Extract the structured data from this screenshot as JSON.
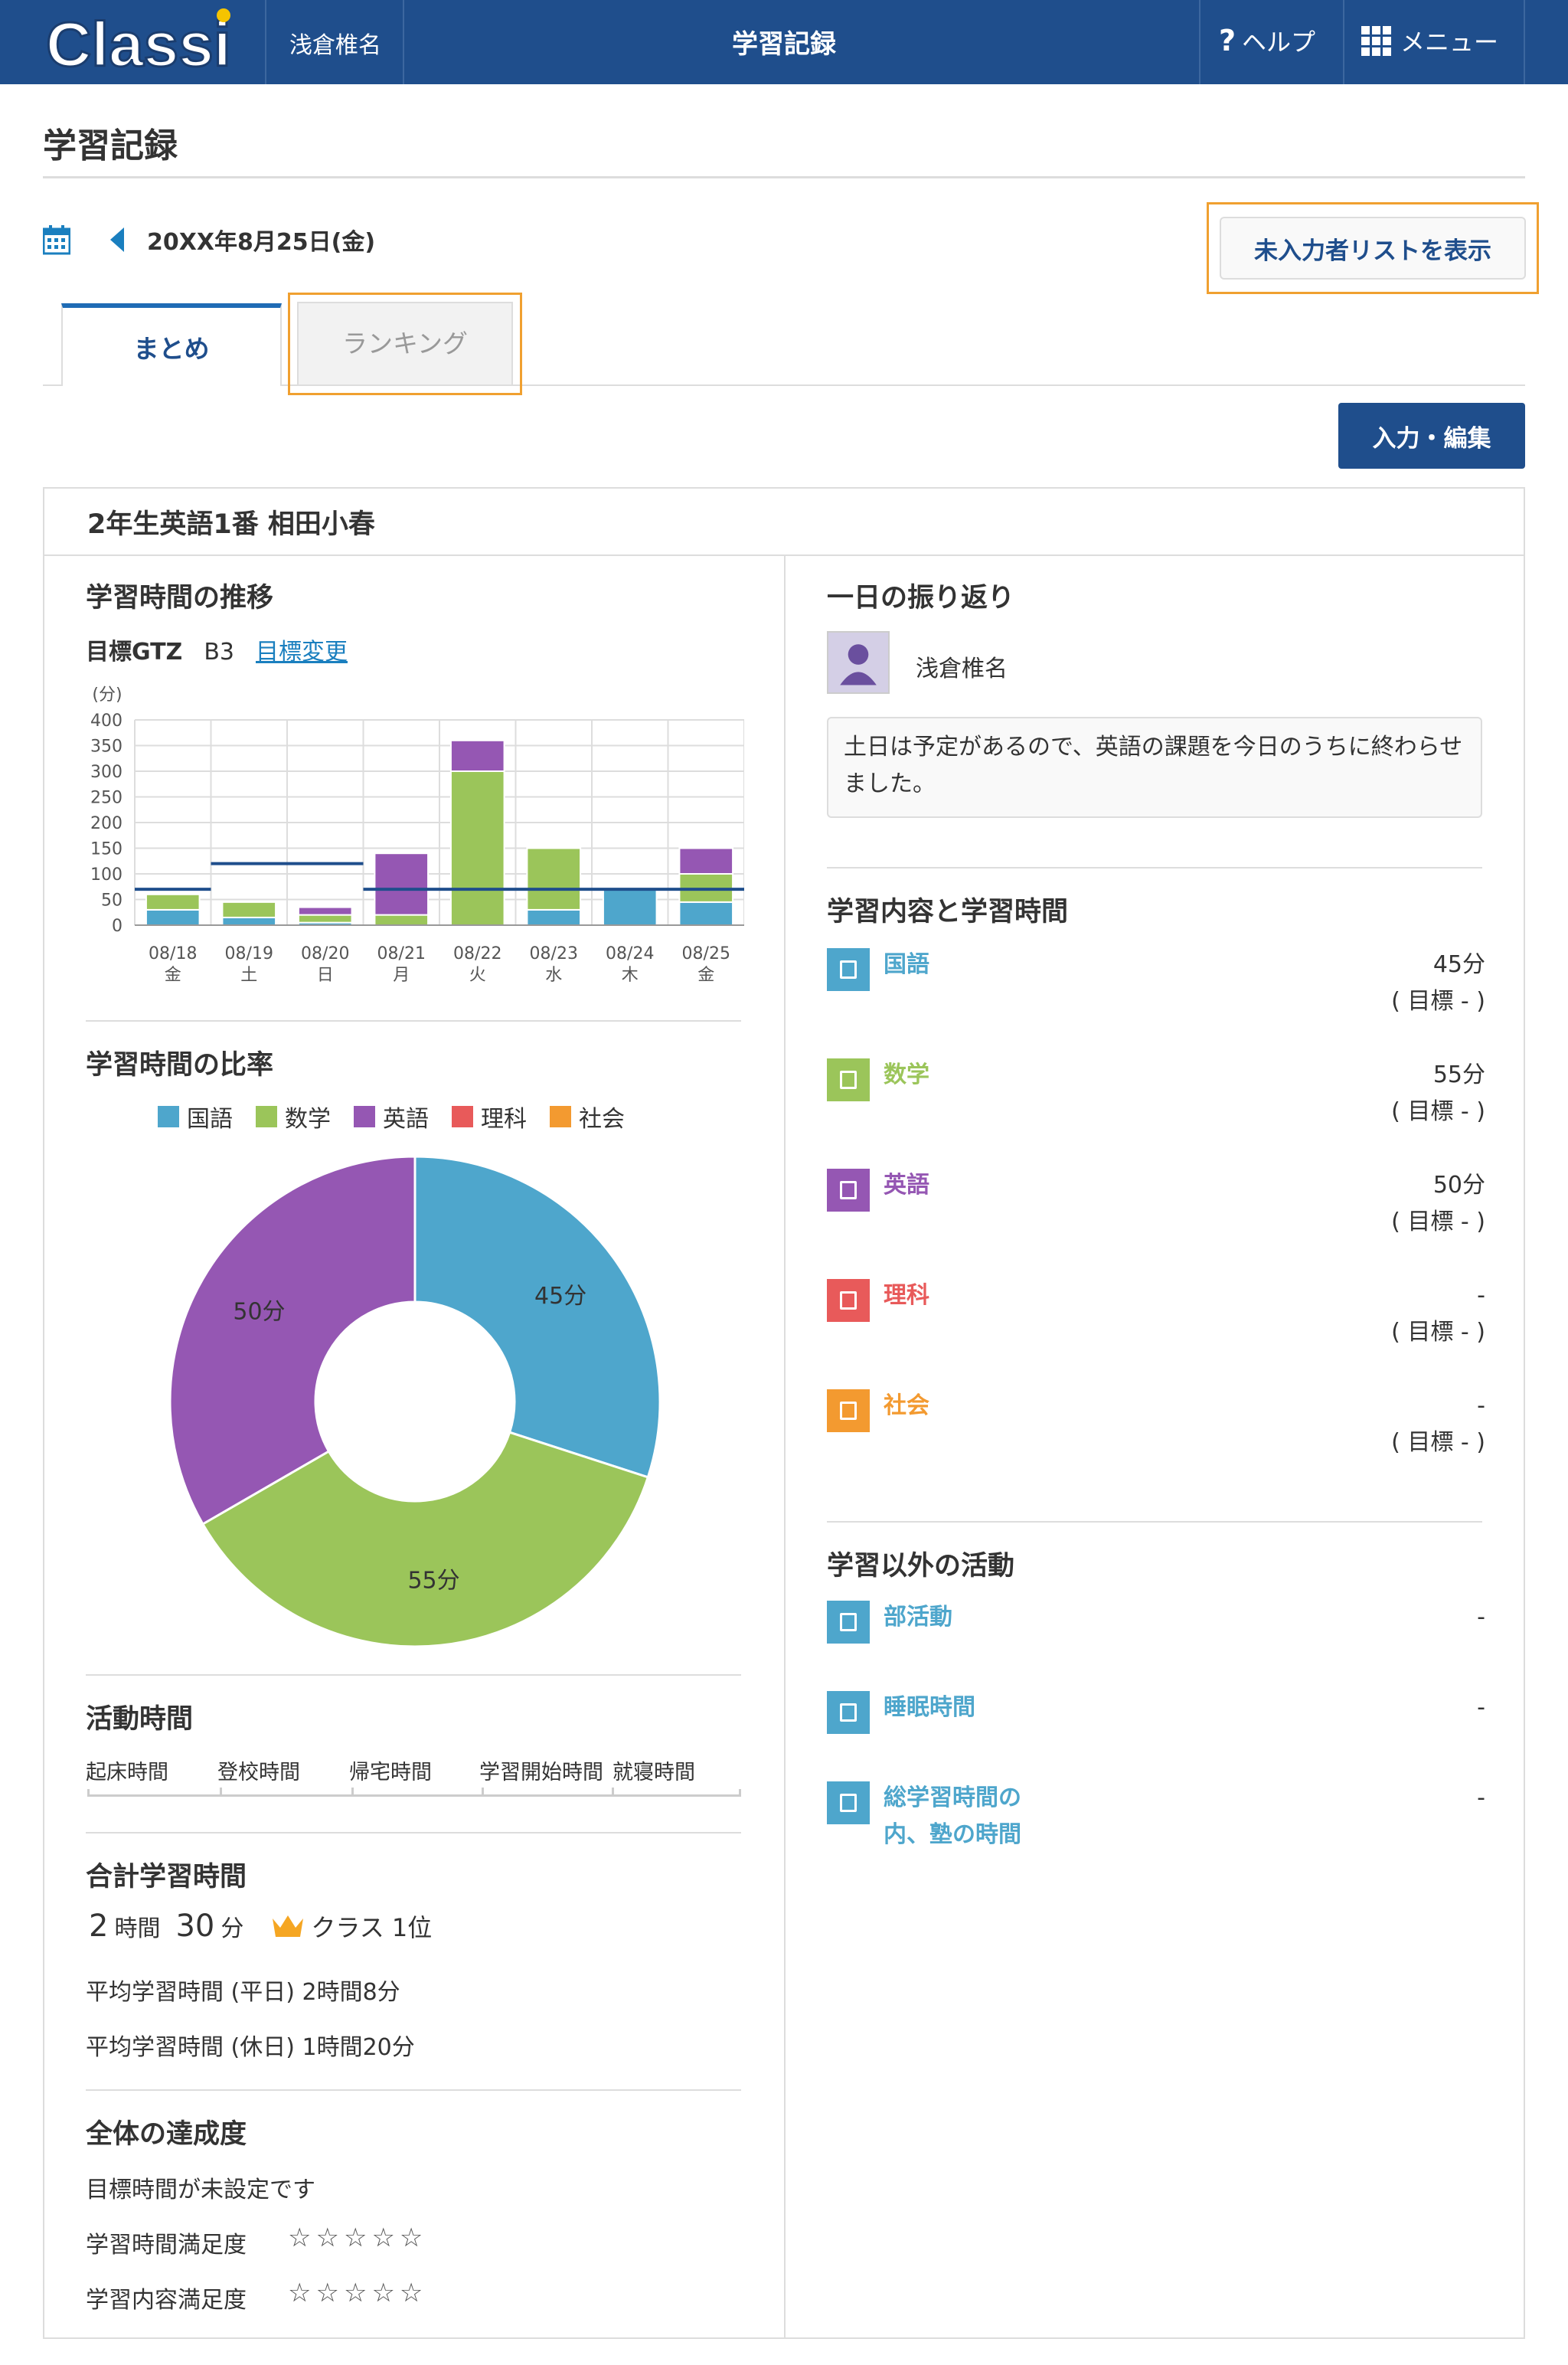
{
  "header": {
    "logo_text": "Classi",
    "user_name": "浅倉椎名",
    "screen_title": "学習記録",
    "help_label": "ヘルプ",
    "menu_label": "メニュー"
  },
  "page": {
    "title": "学習記録",
    "date": "20XX年8月25日(金)",
    "unentered_button": "未入力者リストを表示",
    "tabs": [
      {
        "label": "まとめ",
        "active": true
      },
      {
        "label": "ランキング",
        "active": false
      }
    ],
    "edit_button": "入力・編集"
  },
  "student": {
    "heading": "2年生英語1番 相田小春"
  },
  "trend": {
    "title": "学習時間の推移",
    "goal_label": "目標GTZ",
    "goal_value": "B3",
    "goal_change_link": "目標変更"
  },
  "ratio": {
    "title": "学習時間の比率"
  },
  "colors": {
    "japanese": "#4ea6cc",
    "math": "#9bc55a",
    "english": "#9557b3",
    "science": "#e85a5a",
    "social": "#f39a30",
    "brand": "#1f4e8c"
  },
  "chart_data": [
    {
      "type": "bar",
      "stacked": true,
      "yunit": "(分)",
      "ylim": [
        0,
        400
      ],
      "yticks": [
        0,
        50,
        100,
        150,
        200,
        250,
        300,
        350,
        400
      ],
      "categories": [
        "08/18",
        "08/19",
        "08/20",
        "08/21",
        "08/22",
        "08/23",
        "08/24",
        "08/25"
      ],
      "weekdays": [
        "金",
        "土",
        "日",
        "月",
        "火",
        "水",
        "木",
        "金"
      ],
      "series": [
        {
          "color": "#4ea6cc",
          "values": [
            30,
            15,
            5,
            0,
            0,
            30,
            70,
            45
          ]
        },
        {
          "color": "#9bc55a",
          "values": [
            30,
            30,
            15,
            20,
            300,
            120,
            0,
            55
          ]
        },
        {
          "color": "#9557b3",
          "values": [
            0,
            0,
            15,
            120,
            60,
            0,
            0,
            50
          ]
        }
      ],
      "goal_line": [
        70,
        120,
        120,
        70,
        70,
        70,
        70,
        70
      ],
      "grid": true
    },
    {
      "type": "pie",
      "donut": true,
      "legend": [
        "国語",
        "数学",
        "英語",
        "理科",
        "社会"
      ],
      "legend_colors": [
        "#4ea6cc",
        "#9bc55a",
        "#9557b3",
        "#e85a5a",
        "#f39a30"
      ],
      "slices": [
        {
          "label": "45分",
          "value": 45,
          "color": "#4ea6cc"
        },
        {
          "label": "55分",
          "value": 55,
          "color": "#9bc55a"
        },
        {
          "label": "50分",
          "value": 50,
          "color": "#9557b3"
        }
      ]
    }
  ],
  "activity": {
    "title": "活動時間",
    "labels": [
      "起床時間",
      "登校時間",
      "帰宅時間",
      "学習開始時間",
      "就寝時間"
    ]
  },
  "total": {
    "title": "合計学習時間",
    "hours": "2",
    "hours_unit": "時間",
    "minutes": "30",
    "minutes_unit": "分",
    "rank": "クラス 1位",
    "avg_weekday": "平均学習時間 (平日) 2時間8分",
    "avg_holiday": "平均学習時間 (休日) 1時間20分"
  },
  "achievement": {
    "title": "全体の達成度",
    "no_goal": "目標時間が未設定です",
    "time_satisfaction": "学習時間満足度",
    "content_satisfaction": "学習内容満足度",
    "stars_time": "☆☆☆☆☆",
    "stars_content": "☆☆☆☆☆"
  },
  "review": {
    "title": "一日の振り返り",
    "author": "浅倉椎名",
    "comment": "土日は予定があるので、英語の課題を今日のうちに終わらせました。"
  },
  "content": {
    "title": "学習内容と学習時間",
    "subjects": [
      {
        "name": "国語",
        "time": "45分",
        "goal": "( 目標 - )",
        "color": "#4ea6cc"
      },
      {
        "name": "数学",
        "time": "55分",
        "goal": "( 目標 - )",
        "color": "#9bc55a"
      },
      {
        "name": "英語",
        "time": "50分",
        "goal": "( 目標 - )",
        "color": "#9557b3"
      },
      {
        "name": "理科",
        "time": "-",
        "goal": "( 目標 - )",
        "color": "#e85a5a"
      },
      {
        "name": "社会",
        "time": "-",
        "goal": "( 目標 - )",
        "color": "#f39a30"
      }
    ]
  },
  "other": {
    "title": "学習以外の活動",
    "items": [
      {
        "name": "部活動",
        "value": "-"
      },
      {
        "name": "睡眠時間",
        "value": "-"
      },
      {
        "name": "総学習時間の内、塾の時間",
        "value": "-"
      }
    ]
  }
}
